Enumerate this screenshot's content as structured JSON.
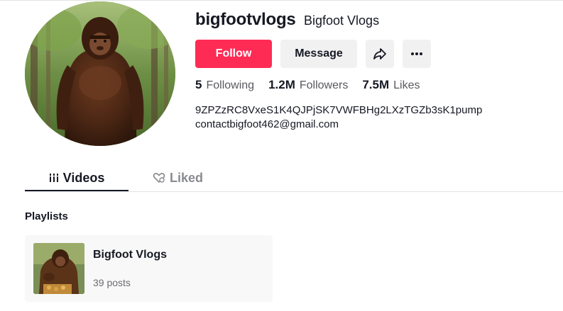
{
  "profile": {
    "username": "bigfootvlogs",
    "nickname": "Bigfoot Vlogs",
    "avatar_alt": "bigfoot avatar"
  },
  "actions": {
    "follow_label": "Follow",
    "message_label": "Message",
    "share_icon": "share-icon",
    "more_icon": "more-icon"
  },
  "stats": [
    {
      "value": "5",
      "label": "Following"
    },
    {
      "value": "1.2M",
      "label": "Followers"
    },
    {
      "value": "7.5M",
      "label": "Likes"
    }
  ],
  "bio": {
    "line1": "9ZPZzRC8VxeS1K4QJPjSK7VWFBHg2LXzTGZb3sK1pump",
    "line2": "contactbigfoot462@gmail.com"
  },
  "tabs": [
    {
      "label": "Videos",
      "icon": "grid-icon",
      "active": true
    },
    {
      "label": "Liked",
      "icon": "liked-heart-icon",
      "active": false
    }
  ],
  "playlists": {
    "title": "Playlists",
    "items": [
      {
        "name": "Bigfoot Vlogs",
        "count": "39 posts"
      }
    ]
  },
  "colors": {
    "accent": "#fe2c55",
    "button_bg": "#f1f1f2",
    "text_primary": "#161823",
    "text_secondary": "#59595f"
  }
}
